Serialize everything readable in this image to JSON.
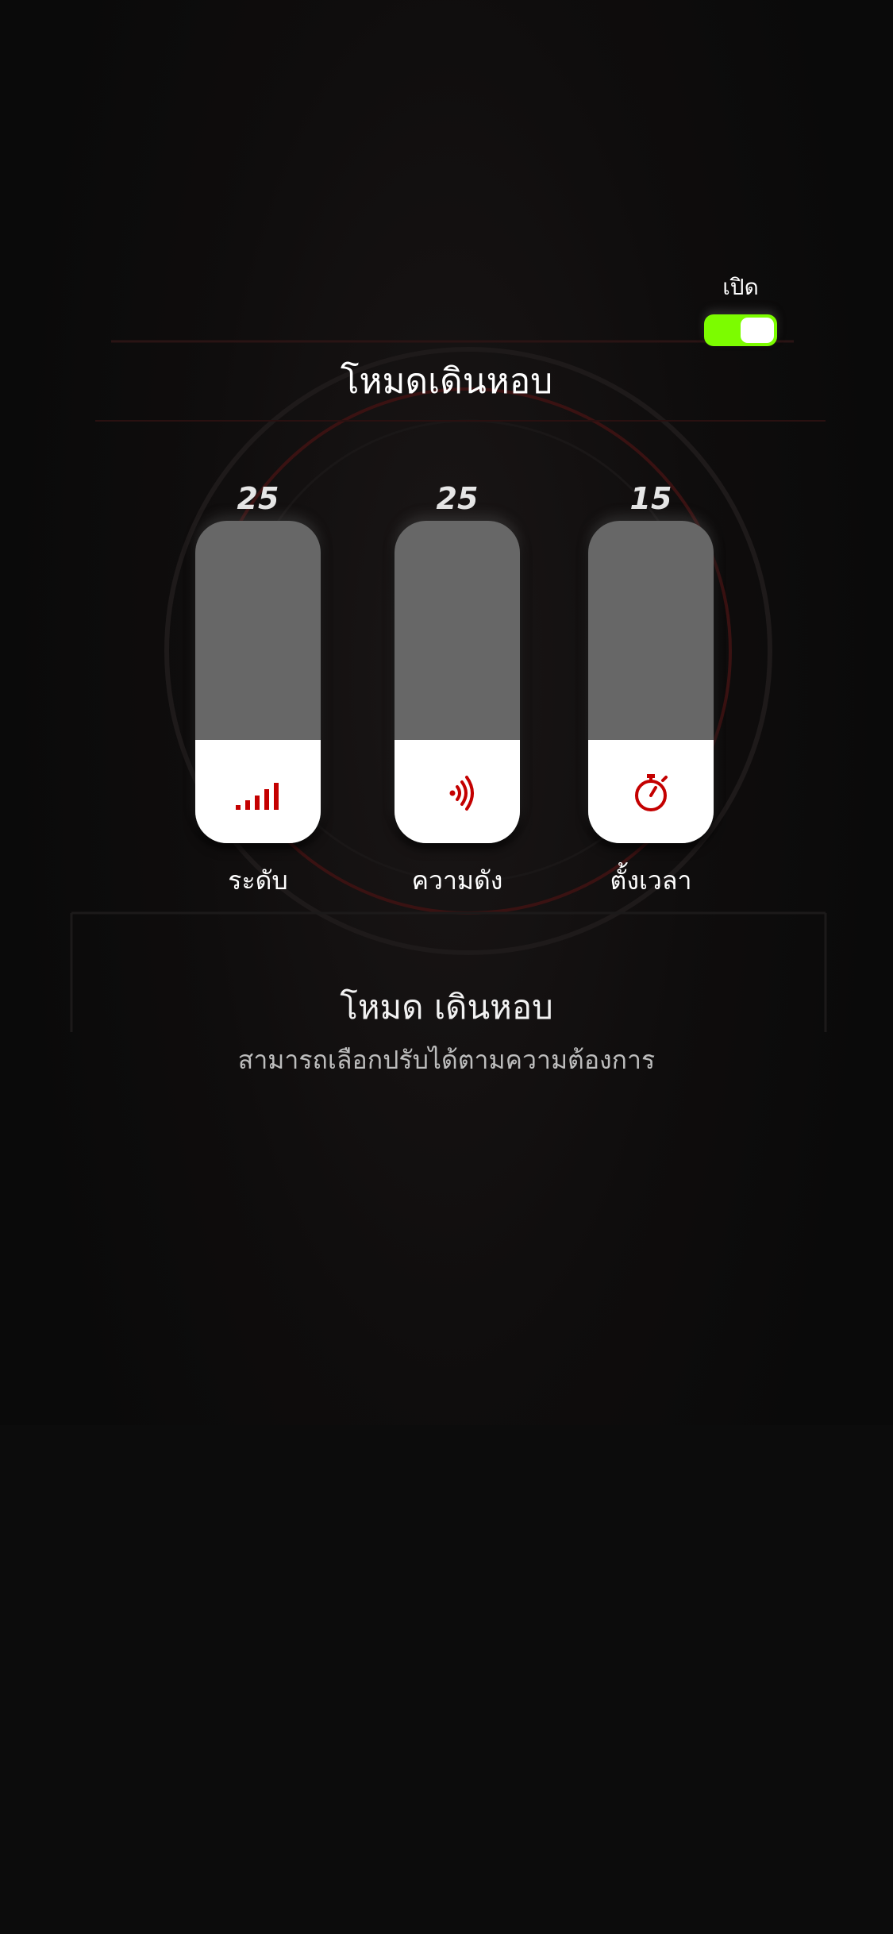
{
  "toggle": {
    "label": "เปิด",
    "on": true,
    "on_color": "#7cfc00"
  },
  "title": "โหมดเดินหอบ",
  "sliders": [
    {
      "value": "25",
      "caption": "ระดับ",
      "icon": "signal-bars-icon",
      "level": 0.32
    },
    {
      "value": "25",
      "caption": "ความดัง",
      "icon": "sound-waves-icon",
      "level": 0.32
    },
    {
      "value": "15",
      "caption": "ตั้งเวลา",
      "icon": "stopwatch-icon",
      "level": 0.32
    }
  ],
  "info": {
    "title": "โหมด เดินหอบ",
    "subtitle": "สามารถเลือกปรับได้ตามความต้องการ"
  },
  "colors": {
    "accent": "#c40000",
    "track": "#676767",
    "fill": "#ffffff"
  }
}
